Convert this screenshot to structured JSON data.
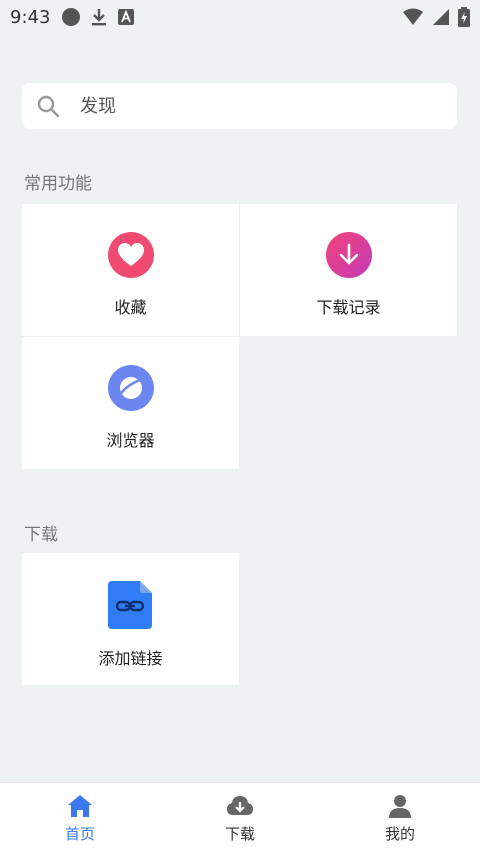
{
  "status_bar": {
    "time": "9:43",
    "icons": [
      "record-dot-icon",
      "download-icon",
      "keyboard-a-icon",
      "wifi-icon",
      "signal-icon",
      "battery-charging-icon"
    ]
  },
  "search": {
    "placeholder": "发现",
    "icon": "search-icon"
  },
  "sections": {
    "common": {
      "title": "常用功能",
      "items": [
        {
          "label": "收藏",
          "icon": "heart-icon",
          "color": "#ef4a70"
        },
        {
          "label": "下载记录",
          "icon": "download-arrow-icon",
          "color": "#e6399e"
        },
        {
          "label": "浏览器",
          "icon": "planet-icon",
          "color": "#6c86f0"
        }
      ]
    },
    "download": {
      "title": "下载",
      "items": [
        {
          "label": "添加链接",
          "icon": "link-file-icon",
          "color": "#2f7cf6"
        }
      ]
    }
  },
  "bottom_nav": {
    "items": [
      {
        "label": "首页",
        "icon": "home-icon",
        "active": true
      },
      {
        "label": "下载",
        "icon": "cloud-download-icon",
        "active": false
      },
      {
        "label": "我的",
        "icon": "user-icon",
        "active": false
      }
    ]
  },
  "colors": {
    "accent": "#3a78f0",
    "background": "#eef2f3"
  }
}
